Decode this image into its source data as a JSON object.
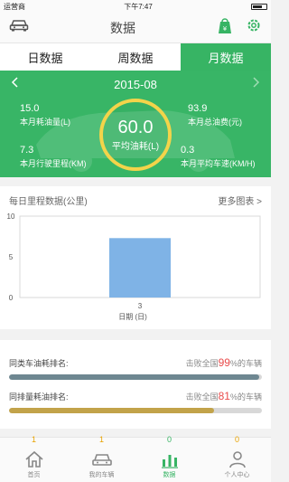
{
  "statusbar": {
    "carrier": "运营商",
    "time": "下午7:47"
  },
  "navbar": {
    "title": "数据",
    "left_icon": "car-icon",
    "right_icons": [
      "share-bag-icon",
      "settings-gear-icon"
    ]
  },
  "tabs": [
    {
      "label": "日数据",
      "active": false
    },
    {
      "label": "周数据",
      "active": false
    },
    {
      "label": "月数据",
      "active": true
    }
  ],
  "hero": {
    "month": "2015-08",
    "center": {
      "value": "60.0",
      "label": "平均油耗(L)"
    },
    "stats": {
      "fuel_used": {
        "value": "15.0",
        "label": "本月耗油量(L)"
      },
      "fuel_cost": {
        "value": "93.9",
        "label": "本月总油费(元)"
      },
      "mileage": {
        "value": "7.3",
        "label": "本月行驶里程(KM)"
      },
      "avg_speed": {
        "value": "0.3",
        "label": "本月平均车速(KM/H)"
      }
    }
  },
  "chart_section": {
    "title": "每日里程数据(公里)",
    "more_label": "更多图表 >"
  },
  "chart_data": {
    "type": "bar",
    "categories": [
      "3"
    ],
    "values": [
      7.3
    ],
    "xlabel": "日期 (日)",
    "ylabel": "",
    "ylim": [
      0,
      10
    ],
    "yticks": [
      "0",
      "5",
      "10"
    ],
    "bar_color": "#7fb3e6"
  },
  "rankings": [
    {
      "label": "同类车油耗排名:",
      "prefix": "击败全国",
      "percent": "99",
      "suffix": "%的车辆",
      "fill": 0.99,
      "color": "#6e8791"
    },
    {
      "label": "同排量耗油排名:",
      "prefix": "击败全国",
      "percent": "81",
      "suffix": "%的车辆",
      "fill": 0.81,
      "color": "#c2a34a"
    }
  ],
  "bottom_nav": [
    {
      "label": "首页",
      "badge": "1",
      "icon": "home-icon",
      "active": false
    },
    {
      "label": "我的车辆",
      "badge": "1",
      "icon": "car-icon",
      "active": false
    },
    {
      "label": "数据",
      "badge": "0",
      "icon": "bar-chart-icon",
      "active": true
    },
    {
      "label": "个人中心",
      "badge": "0",
      "icon": "person-icon",
      "active": false
    }
  ],
  "colors": {
    "accent": "#37b464",
    "gauge_ring": "#f3d44a",
    "highlight": "#e94b4b"
  }
}
